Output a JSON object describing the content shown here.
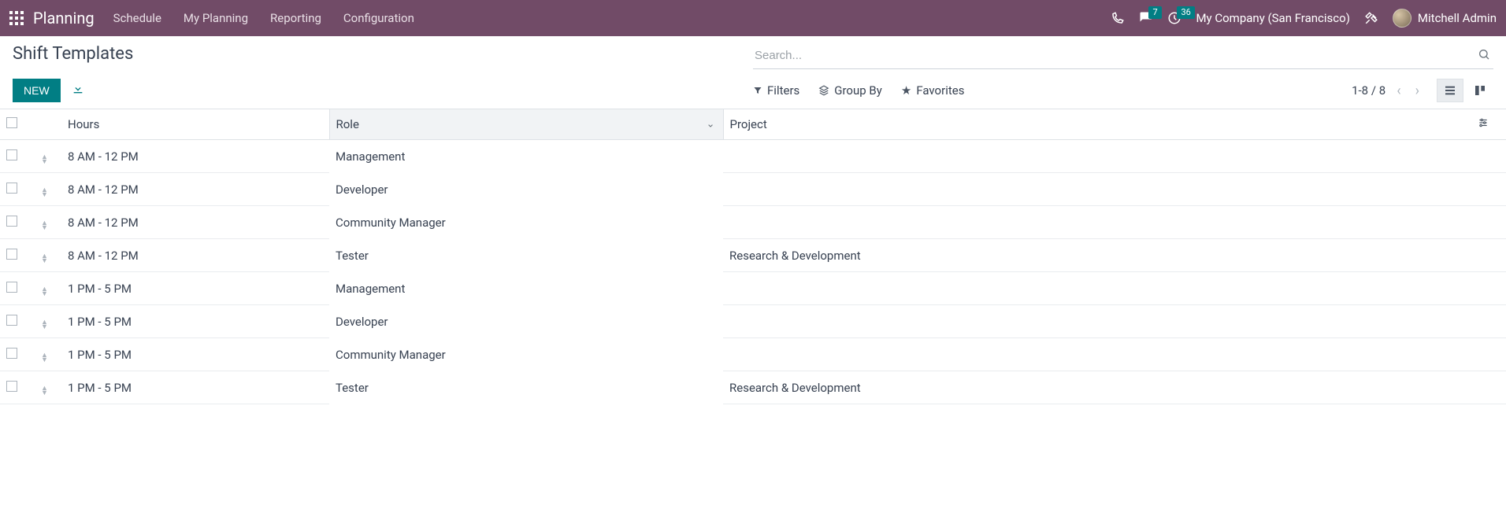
{
  "navbar": {
    "brand": "Planning",
    "menu": [
      "Schedule",
      "My Planning",
      "Reporting",
      "Configuration"
    ],
    "messages_badge": "7",
    "activities_badge": "36",
    "company": "My Company (San Francisco)",
    "user": "Mitchell Admin"
  },
  "page": {
    "title": "Shift Templates",
    "new_button": "NEW",
    "search_placeholder": "Search..."
  },
  "search_options": {
    "filters": "Filters",
    "group_by": "Group By",
    "favorites": "Favorites"
  },
  "pager": {
    "range": "1-8 / 8"
  },
  "columns": {
    "hours": "Hours",
    "role": "Role",
    "project": "Project"
  },
  "rows": [
    {
      "hours": "8 AM - 12 PM",
      "role": "Management",
      "project": ""
    },
    {
      "hours": "8 AM - 12 PM",
      "role": "Developer",
      "project": ""
    },
    {
      "hours": "8 AM - 12 PM",
      "role": "Community Manager",
      "project": ""
    },
    {
      "hours": "8 AM - 12 PM",
      "role": "Tester",
      "project": "Research & Development"
    },
    {
      "hours": "1 PM - 5 PM",
      "role": "Management",
      "project": ""
    },
    {
      "hours": "1 PM - 5 PM",
      "role": "Developer",
      "project": ""
    },
    {
      "hours": "1 PM - 5 PM",
      "role": "Community Manager",
      "project": ""
    },
    {
      "hours": "1 PM - 5 PM",
      "role": "Tester",
      "project": "Research & Development"
    }
  ]
}
